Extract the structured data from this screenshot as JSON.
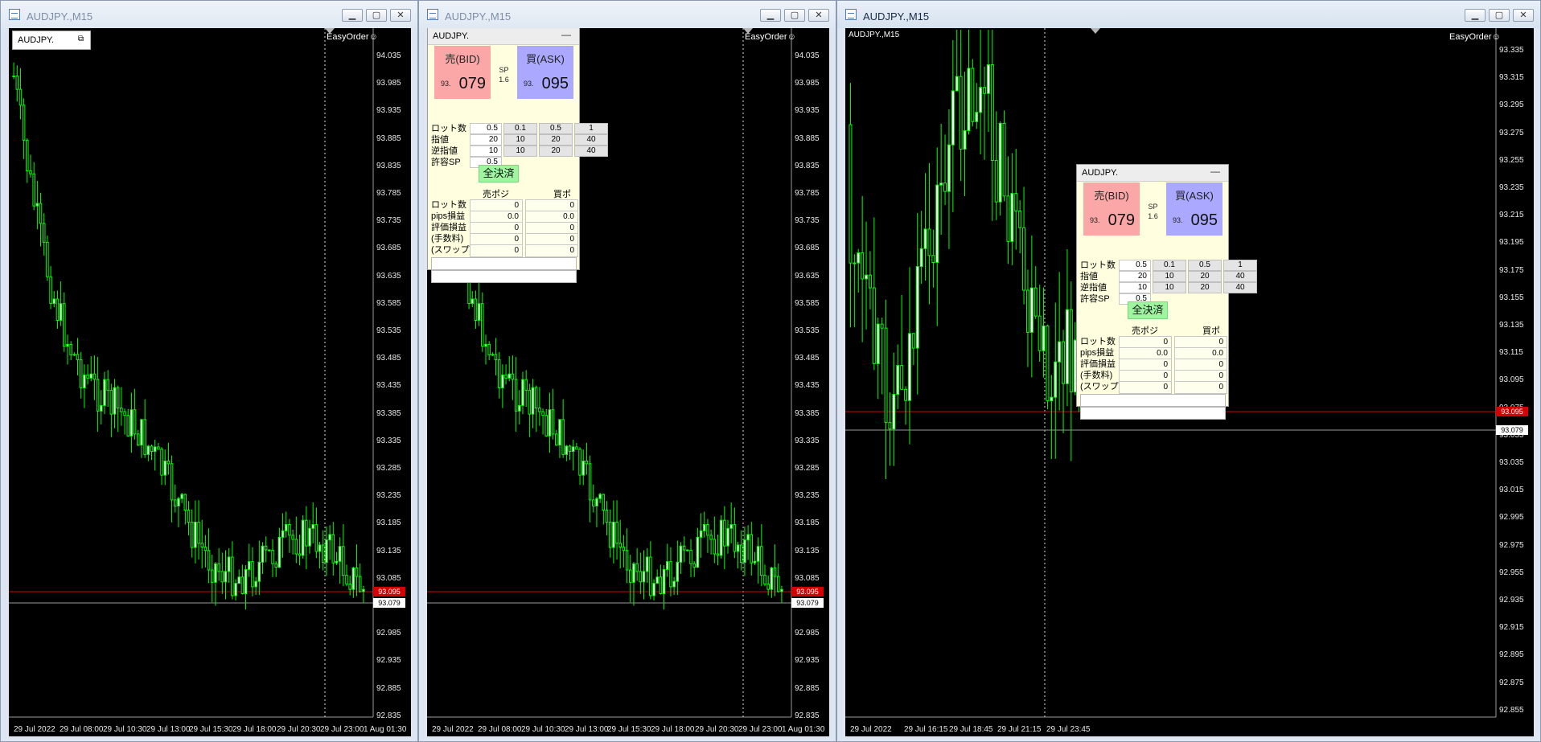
{
  "windows": [
    {
      "title": "AUDJPY.,M15",
      "symbol_label": "AUDJPY.",
      "easyorder_label": "EasyOrder☺",
      "y_labels": [
        "94.035",
        "93.985",
        "93.935",
        "93.885",
        "93.835",
        "93.785",
        "93.735",
        "93.685",
        "93.635",
        "93.585",
        "93.535",
        "93.485",
        "93.435",
        "93.385",
        "93.335",
        "93.285",
        "93.235",
        "93.185",
        "93.135",
        "93.085",
        "93.035",
        "92.985",
        "92.935",
        "92.885",
        "92.835"
      ],
      "x_labels": [
        "29 Jul 2022",
        "29 Jul 08:00",
        "29 Jul 10:30",
        "29 Jul 13:00",
        "29 Jul 15:30",
        "29 Jul 18:00",
        "29 Jul 20:30",
        "29 Jul 23:00",
        "1 Aug 01:30"
      ],
      "bid_tag": "93.095",
      "ask_tag": "93.079",
      "candle_color": "#00ff00"
    },
    {
      "title": "AUDJPY.,M15",
      "easyorder_label": "EasyOrder☺",
      "y_labels": [
        "94.035",
        "93.985",
        "93.935",
        "93.885",
        "93.835",
        "93.785",
        "93.735",
        "93.685",
        "93.635",
        "93.585",
        "93.535",
        "93.485",
        "93.435",
        "93.385",
        "93.335",
        "93.285",
        "93.235",
        "93.185",
        "93.135",
        "93.085",
        "93.035",
        "92.985",
        "92.935",
        "92.885",
        "92.835"
      ],
      "x_labels": [
        "29 Jul 2022",
        "29 Jul 08:00",
        "29 Jul 10:30",
        "29 Jul 13:00",
        "29 Jul 15:30",
        "29 Jul 18:00",
        "29 Jul 20:30",
        "29 Jul 23:00",
        "1 Aug 01:30"
      ],
      "bid_tag": "93.095",
      "ask_tag": "93.079"
    },
    {
      "title": "AUDJPY.,M15",
      "symbol_label": "AUDJPY.,M15",
      "easyorder_label": "EasyOrder☺",
      "y_labels": [
        "93.335",
        "93.315",
        "93.295",
        "93.275",
        "93.255",
        "93.235",
        "93.215",
        "93.195",
        "93.175",
        "93.155",
        "93.135",
        "93.115",
        "93.095",
        "93.075",
        "93.055",
        "93.035",
        "93.015",
        "92.995",
        "92.975",
        "92.955",
        "92.935",
        "92.915",
        "92.895",
        "92.875",
        "92.855"
      ],
      "x_labels": [
        "29 Jul 2022",
        "29 Jul 16:15",
        "29 Jul 18:45",
        "29 Jul 21:15",
        "29 Jul 23:45"
      ],
      "bid_tag": "93.095",
      "ask_tag": "93.079"
    }
  ],
  "panel": {
    "title": "AUDJPY.",
    "minimize": "—",
    "bid_label": "売(BID)",
    "ask_label": "買(ASK)",
    "bid_small": "93.",
    "bid_big": "079",
    "ask_small": "93.",
    "ask_big": "095",
    "sp_label": "SP",
    "sp_value": "1.6",
    "rows": [
      {
        "label": "ロット数",
        "value": "0.5",
        "buttons": [
          "0.1",
          "0.5",
          "1"
        ]
      },
      {
        "label": "指値",
        "value": "20",
        "buttons": [
          "10",
          "20",
          "40"
        ]
      },
      {
        "label": "逆指値",
        "value": "10",
        "buttons": [
          "10",
          "20",
          "40"
        ]
      },
      {
        "label": "許容SP",
        "value": "0.5",
        "buttons": []
      }
    ],
    "close_all": "全決済",
    "sell_header": "売ポジ",
    "buy_header": "買ポジ",
    "pos_rows": [
      {
        "label": "ロット数",
        "sell": "0",
        "buy": "0"
      },
      {
        "label": "pips損益",
        "sell": "0.0",
        "buy": "0.0"
      },
      {
        "label": "評価損益",
        "sell": "0",
        "buy": "0"
      },
      {
        "label": "(手数料)",
        "sell": "0",
        "buy": "0"
      },
      {
        "label": "(スワップ)",
        "sell": "0",
        "buy": "0"
      }
    ]
  }
}
